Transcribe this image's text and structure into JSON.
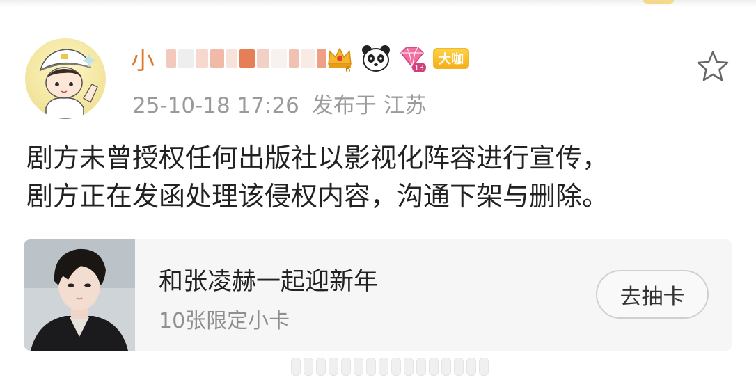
{
  "post": {
    "username_visible": "小",
    "badges": {
      "crown_level": "6",
      "gem_level": "13",
      "dk_label": "大咖"
    },
    "timestamp": "25-10-18 17:26",
    "location": "发布于 江苏",
    "content_lines": [
      "剧方未曾授权任何出版社以影视化阵容进行宣传，",
      "剧方正在发函处理该侵权内容，沟通下架与删除。"
    ]
  },
  "card": {
    "title": "和张凌赫一起迎新年",
    "subtitle": "10张限定小卡",
    "button_label": "去抽卡"
  },
  "icons": {
    "star": "star-outline-icon",
    "crown": "crown-icon",
    "panda": "panda-icon",
    "gem": "diamond-icon"
  },
  "colors": {
    "username": "#e0782a",
    "meta": "#9a9a9a",
    "text": "#222222",
    "dk_badge": "#f4ad16"
  }
}
